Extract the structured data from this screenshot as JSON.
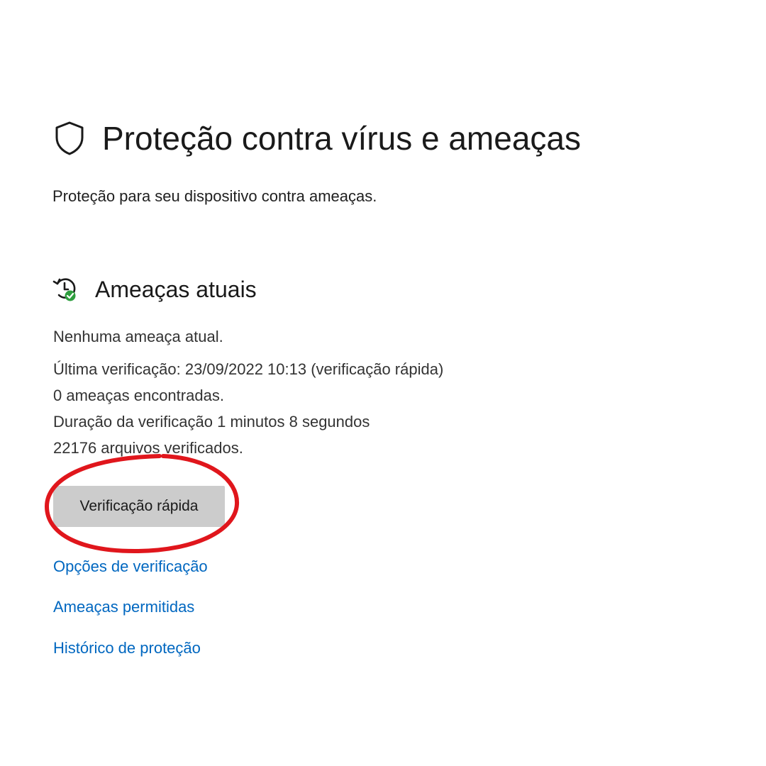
{
  "page": {
    "title": "Proteção contra vírus e ameaças",
    "subtitle": "Proteção para seu dispositivo contra ameaças.",
    "icon": "shield-icon"
  },
  "current_threats": {
    "heading": "Ameaças atuais",
    "icon": "threat-history-icon",
    "status": "Nenhuma ameaça atual.",
    "last_scan": "Última verificação: 23/09/2022 10:13 (verificação rápida)",
    "threats_found": "0 ameaças encontradas.",
    "scan_duration": "Duração da verificação 1 minutos 8 segundos",
    "files_scanned": "22176 arquivos verificados.",
    "quick_scan_label": "Verificação rápida"
  },
  "links": {
    "scan_options": "Opções de verificação",
    "allowed_threats": "Ameaças permitidas",
    "protection_history": "Histórico de proteção"
  },
  "colors": {
    "link": "#0067c0",
    "button_bg": "#cccccc",
    "annotation": "#e0161c",
    "ok_badge": "#2e9e3e"
  }
}
